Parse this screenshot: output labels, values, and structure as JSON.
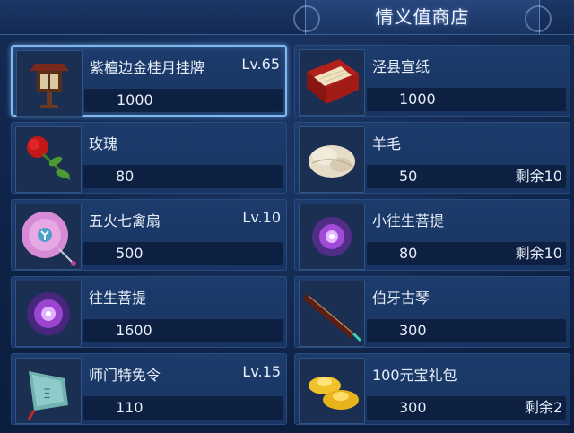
{
  "shop": {
    "title": "情义值商店",
    "items": [
      {
        "name": "紫檀边金桂月挂牌",
        "level": "Lv.65",
        "price": "1000",
        "remaining": "",
        "icon": "wooden-lantern-icon"
      },
      {
        "name": "泾县宣纸",
        "level": "",
        "price": "1000",
        "remaining": "",
        "icon": "paper-box-icon"
      },
      {
        "name": "玫瑰",
        "level": "",
        "price": "80",
        "remaining": "",
        "icon": "rose-icon"
      },
      {
        "name": "羊毛",
        "level": "",
        "price": "50",
        "remaining": "剩余10",
        "icon": "wool-icon"
      },
      {
        "name": "五火七禽扇",
        "level": "Lv.10",
        "price": "500",
        "remaining": "",
        "icon": "feather-fan-icon"
      },
      {
        "name": "小往生菩提",
        "level": "",
        "price": "80",
        "remaining": "剩余10",
        "icon": "purple-flower-icon"
      },
      {
        "name": "往生菩提",
        "level": "",
        "price": "1600",
        "remaining": "",
        "icon": "purple-flower-icon"
      },
      {
        "name": "伯牙古琴",
        "level": "",
        "price": "300",
        "remaining": "",
        "icon": "guqin-icon"
      },
      {
        "name": "师门特免令",
        "level": "Lv.15",
        "price": "110",
        "remaining": "",
        "icon": "jade-token-icon"
      },
      {
        "name": "100元宝礼包",
        "level": "",
        "price": "300",
        "remaining": "剩余2",
        "icon": "gold-ingot-icon"
      }
    ]
  }
}
